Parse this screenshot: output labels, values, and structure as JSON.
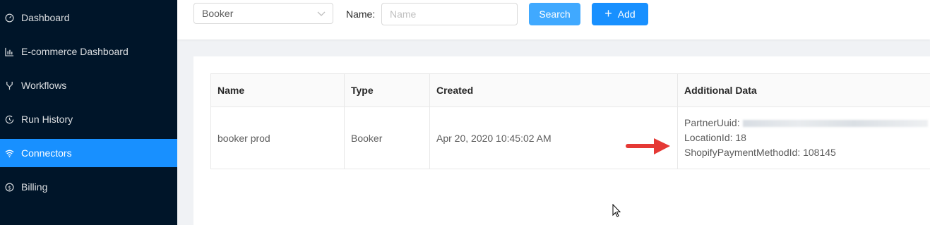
{
  "sidebar": {
    "items": [
      {
        "label": "Dashboard",
        "icon": "dashboard-icon"
      },
      {
        "label": "E-commerce Dashboard",
        "icon": "bar-chart-icon"
      },
      {
        "label": "Workflows",
        "icon": "branch-icon"
      },
      {
        "label": "Run History",
        "icon": "history-icon"
      },
      {
        "label": "Connectors",
        "icon": "wifi-icon",
        "active": true
      },
      {
        "label": "Billing",
        "icon": "dollar-icon"
      }
    ]
  },
  "filter": {
    "type_value": "Booker",
    "name_label": "Name",
    "name_placeholder": "Name",
    "search_label": "Search",
    "add_label": "Add"
  },
  "table": {
    "headers": [
      "Name",
      "Type",
      "Created",
      "Additional Data"
    ],
    "rows": [
      {
        "name": "booker prod",
        "type": "Booker",
        "created": "Apr 20, 2020 10:45:02 AM",
        "additional": {
          "partner_uuid_label": "PartnerUuid:",
          "location_id": "LocationId: 18",
          "shopify_payment": "ShopifyPaymentMethodId: 108145"
        }
      }
    ]
  },
  "colors": {
    "sidebar_bg": "#001529",
    "primary": "#1890ff",
    "annotation_arrow": "#e53935"
  }
}
